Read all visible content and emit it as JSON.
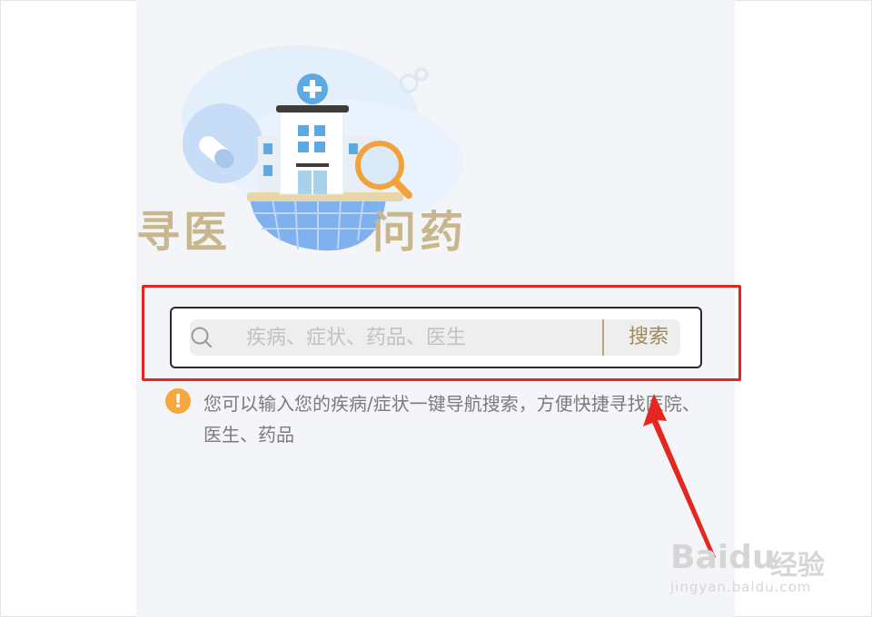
{
  "hero": {
    "title_left": "寻医",
    "title_right": "问药"
  },
  "search": {
    "placeholder": "疾病、症状、药品、医生",
    "value": "",
    "button_label": "搜索"
  },
  "tip": {
    "icon": "exclamation-icon",
    "icon_glyph": "!",
    "text": "您可以输入您的疾病/症状一键导航搜索，方便快捷寻找医院、医生、药品"
  },
  "watermark": {
    "brand": "Baidu",
    "suffix": "经验",
    "url": "jingyan.baidu.com"
  },
  "colors": {
    "accent_gold": "#c8b68d",
    "highlight_red": "#e5271f",
    "tip_orange": "#f5a83d",
    "page_bg": "#f4f5f9"
  }
}
